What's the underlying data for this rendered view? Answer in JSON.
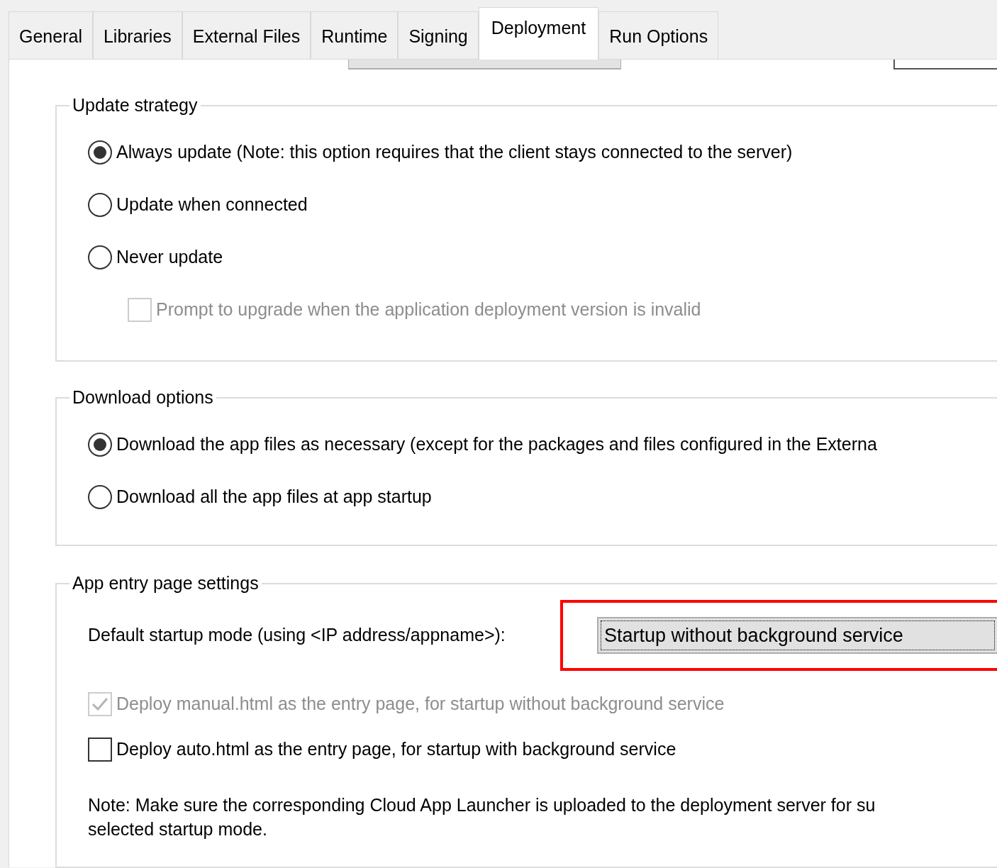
{
  "tabs": [
    {
      "label": "General",
      "selected": false
    },
    {
      "label": "Libraries",
      "selected": false
    },
    {
      "label": "External Files",
      "selected": false
    },
    {
      "label": "Runtime",
      "selected": false
    },
    {
      "label": "Signing",
      "selected": false
    },
    {
      "label": "Deployment",
      "selected": true
    },
    {
      "label": "Run Options",
      "selected": false
    }
  ],
  "groups": [
    {
      "title": "Update strategy",
      "items": [
        {
          "kind": "radio",
          "label": "Always update (Note: this option requires that the client stays connected to the server)",
          "selected": true,
          "disabled": false
        },
        {
          "kind": "radio",
          "label": "Update when connected",
          "selected": false,
          "disabled": false
        },
        {
          "kind": "radio",
          "label": "Never update",
          "selected": false,
          "disabled": false
        },
        {
          "kind": "checkbox",
          "label": "Prompt to upgrade when the application deployment version is invalid",
          "checked": false,
          "disabled": true,
          "indented": true
        }
      ]
    },
    {
      "title": "Download options",
      "items": [
        {
          "kind": "radio",
          "label": "Download the app files as necessary (except for the packages and files configured in the Externa",
          "selected": true,
          "disabled": false
        },
        {
          "kind": "radio",
          "label": "Download all the app files at app startup",
          "selected": false,
          "disabled": false
        }
      ]
    },
    {
      "title": "App entry page settings",
      "items": [
        {
          "kind": "combo",
          "label": "Default startup mode (using <IP address/appname>):",
          "value": "Startup without background service",
          "highlighted": true
        },
        {
          "kind": "checkbox",
          "label": "Deploy manual.html as the entry page, for startup without background service",
          "checked": true,
          "disabled": true,
          "indented": false
        },
        {
          "kind": "checkbox",
          "label": "Deploy auto.html as the entry page, for startup with background service",
          "checked": false,
          "disabled": false,
          "indented": false
        },
        {
          "kind": "note",
          "lines": [
            "Note: Make sure the corresponding Cloud App Launcher is uploaded to the deployment server for su",
            "selected startup mode."
          ]
        }
      ]
    }
  ]
}
